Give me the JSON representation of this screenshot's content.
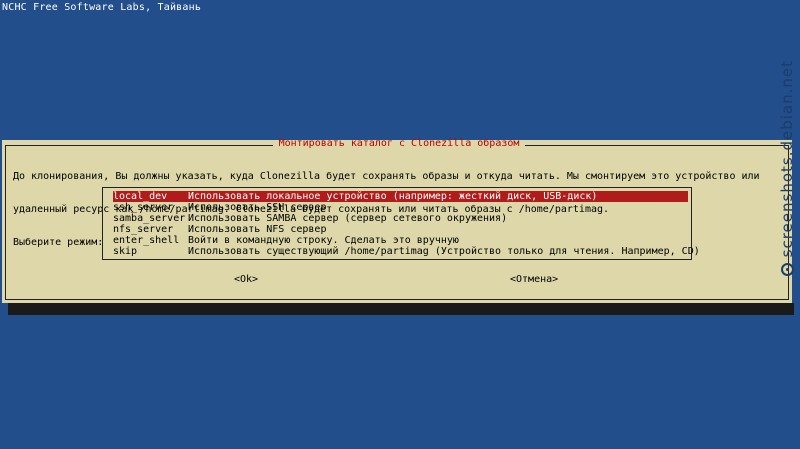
{
  "backtitle": "NCHC Free Software Labs, Тайвань",
  "dialog": {
    "title": "Монтировать каталог с Clonezilla образом",
    "prompt_lines": [
      "До клонирования, Вы должны указать, куда Clonezilla будет сохранять образы и откуда читать. Мы смонтируем это устройство или",
      "удаленный ресурс как /home/partimag. Clonezilla будет сохранять или читать образы с /home/partimag.",
      "Выберите режим:"
    ],
    "menu": [
      {
        "tag": "local_dev",
        "desc": "Использовать локальное устройство (например: жесткий диск, USB-диск)",
        "selected": true
      },
      {
        "tag": "ssh_server",
        "desc": "Использовать SSH сервер",
        "selected": false
      },
      {
        "tag": "samba_server",
        "desc": "Использовать SAMBA сервер (сервер сетевого окружения)",
        "selected": false
      },
      {
        "tag": "nfs_server",
        "desc": "Использовать NFS сервер",
        "selected": false
      },
      {
        "tag": "enter_shell",
        "desc": "Войти в командную строку. Сделать это вручную",
        "selected": false
      },
      {
        "tag": "skip",
        "desc": "Использовать существующий /home/partimag (Устройство только для чтения. Например, CD)",
        "selected": false
      }
    ],
    "ok_label": "<Ok>",
    "cancel_label": "<Отмена>"
  },
  "watermark": "screenshots.debian.net",
  "colors": {
    "background": "#224e8c",
    "dialog": "#ddd7a9",
    "title": "#c00000",
    "selection": "#b01c1c"
  }
}
